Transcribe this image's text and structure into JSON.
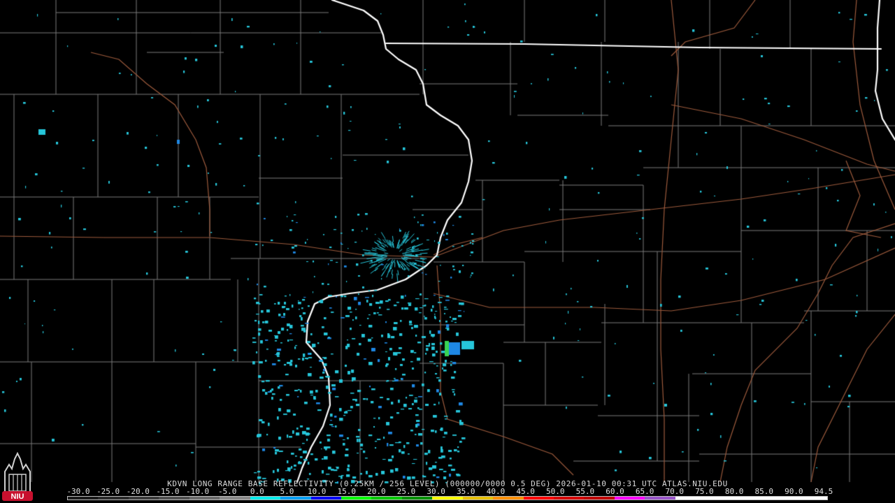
{
  "header": {
    "product_line": "KDVN LONG RANGE BASE REFLECTIVITY (0.25KM / 256 LEVEL) (000000/0000 0.5 DEG) 2026-01-10 00:31 UTC  ATLAS.NIU.EDU"
  },
  "logo": {
    "text": "NIU",
    "color": "#c8102e"
  },
  "scale": {
    "labels": [
      "-30.0",
      "-25.0",
      "-20.0",
      "-15.0",
      "-10.0",
      "-5.0",
      "0.0",
      "5.0",
      "10.0",
      "15.0",
      "20.0",
      "25.0",
      "30.0",
      "35.0",
      "40.0",
      "45.0",
      "50.0",
      "55.0",
      "60.0",
      "65.0",
      "70.0",
      "75.0",
      "80.0",
      "85.0",
      "90.0",
      "94.5"
    ],
    "colors": [
      "#1a1a1a",
      "#2b2b2b",
      "#3c3c3c",
      "#4f4f4f",
      "#6a6a6a",
      "#8a8a8a",
      "#00ecec",
      "#01a0f6",
      "#0000f6",
      "#00ff00",
      "#00c800",
      "#009000",
      "#ffff00",
      "#e7c000",
      "#ff9000",
      "#ff0000",
      "#d60000",
      "#c00000",
      "#ff00ff",
      "#9955c9",
      "#ffffff",
      "#ffffff",
      "#ffffff",
      "#ffffff",
      "#ffffff"
    ]
  },
  "map": {
    "colors": {
      "background": "#000000",
      "county_lines": "#7a7a7a",
      "state_lines": "#ffffff",
      "highways": "#9c5a3c",
      "echo_light": "#26c6da",
      "echo_mid": "#1e88e5",
      "echo_strong": "#39d353"
    }
  }
}
